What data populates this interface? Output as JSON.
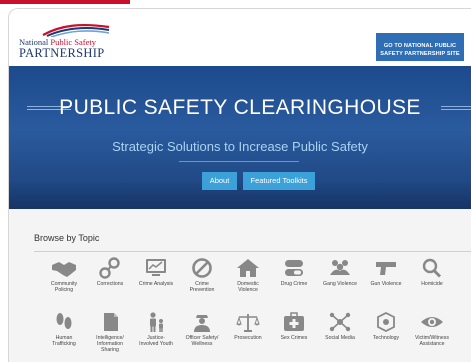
{
  "header": {
    "logo": {
      "line1_a": "National ",
      "line1_b": "Public Safety",
      "line2": "PARTNERSHIP"
    },
    "site_button": {
      "line1": "GO TO NATIONAL PUBLIC",
      "line2": "SAFETY PARTNERSHIP SITE"
    }
  },
  "hero": {
    "title": "PUBLIC SAFETY CLEARINGHOUSE",
    "subtitle": "Strategic Solutions to Increase Public Safety",
    "buttons": {
      "about": "About",
      "featured": "Featured Toolkits"
    }
  },
  "browse": {
    "title": "Browse by Topic",
    "row1": [
      {
        "icon": "handshake-icon",
        "l1": "Community",
        "l2": "Policing",
        "l3": ""
      },
      {
        "icon": "handcuffs-icon",
        "l1": "Corrections",
        "l2": "",
        "l3": ""
      },
      {
        "icon": "monitor-chart-icon",
        "l1": "Crime Analysis",
        "l2": "",
        "l3": ""
      },
      {
        "icon": "no-sign-icon",
        "l1": "Crime",
        "l2": "Prevention",
        "l3": ""
      },
      {
        "icon": "house-icon",
        "l1": "Domestic",
        "l2": "Violence",
        "l3": ""
      },
      {
        "icon": "pills-icon",
        "l1": "Drug Crime",
        "l2": "",
        "l3": ""
      },
      {
        "icon": "group-icon",
        "l1": "Gang Violence",
        "l2": "",
        "l3": ""
      },
      {
        "icon": "gun-icon",
        "l1": "Gun Violence",
        "l2": "",
        "l3": ""
      },
      {
        "icon": "magnifier-icon",
        "l1": "Homicide",
        "l2": "",
        "l3": ""
      }
    ],
    "row2": [
      {
        "icon": "footprints-icon",
        "l1": "Human",
        "l2": "Trafficking",
        "l3": ""
      },
      {
        "icon": "document-icon",
        "l1": "Intelligence/",
        "l2": "Information",
        "l3": "Sharing"
      },
      {
        "icon": "adult-child-icon",
        "l1": "Justice-",
        "l2": "Involved Youth",
        "l3": ""
      },
      {
        "icon": "officer-icon",
        "l1": "Officer Safety/",
        "l2": "Wellness",
        "l3": ""
      },
      {
        "icon": "scales-icon",
        "l1": "Prosecution",
        "l2": "",
        "l3": ""
      },
      {
        "icon": "medical-kit-icon",
        "l1": "Sex Crimes",
        "l2": "",
        "l3": ""
      },
      {
        "icon": "network-icon",
        "l1": "Social Media",
        "l2": "",
        "l3": ""
      },
      {
        "icon": "technology-icon",
        "l1": "Technology",
        "l2": "",
        "l3": ""
      },
      {
        "icon": "eye-icon",
        "l1": "Victim/Witness",
        "l2": "Assistance",
        "l3": ""
      }
    ]
  },
  "colors": {
    "accent_red": "#c8102e",
    "navy": "#1f3a73",
    "button_blue": "#3ca1d9",
    "icon_gray": "#888888"
  }
}
